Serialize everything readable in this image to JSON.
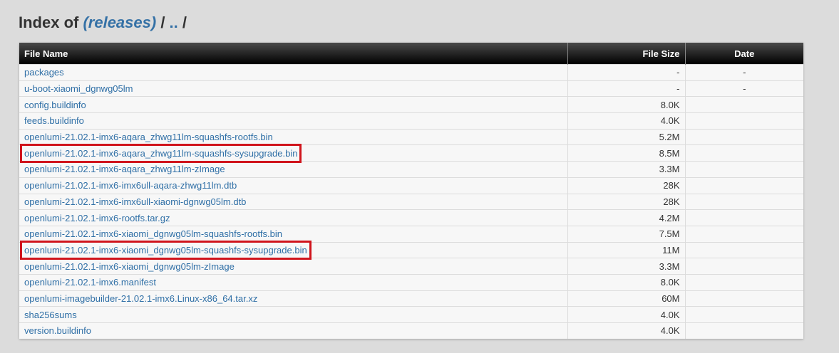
{
  "header": {
    "prefix": "Index of ",
    "root_crumb": "(releases)",
    "sep1": " / ",
    "parent_crumb": "..",
    "sep2": " /"
  },
  "table": {
    "columns": [
      "File Name",
      "File Size",
      "Date"
    ],
    "rows": [
      {
        "name": "packages",
        "size": "-",
        "date": "-",
        "highlighted": false
      },
      {
        "name": "u-boot-xiaomi_dgnwg05lm",
        "size": "-",
        "date": "-",
        "highlighted": false
      },
      {
        "name": "config.buildinfo",
        "size": "8.0K",
        "date": "",
        "highlighted": false
      },
      {
        "name": "feeds.buildinfo",
        "size": "4.0K",
        "date": "",
        "highlighted": false
      },
      {
        "name": "openlumi-21.02.1-imx6-aqara_zhwg11lm-squashfs-rootfs.bin",
        "size": "5.2M",
        "date": "",
        "highlighted": false
      },
      {
        "name": "openlumi-21.02.1-imx6-aqara_zhwg11lm-squashfs-sysupgrade.bin",
        "size": "8.5M",
        "date": "",
        "highlighted": true
      },
      {
        "name": "openlumi-21.02.1-imx6-aqara_zhwg11lm-zImage",
        "size": "3.3M",
        "date": "",
        "highlighted": false
      },
      {
        "name": "openlumi-21.02.1-imx6-imx6ull-aqara-zhwg11lm.dtb",
        "size": "28K",
        "date": "",
        "highlighted": false
      },
      {
        "name": "openlumi-21.02.1-imx6-imx6ull-xiaomi-dgnwg05lm.dtb",
        "size": "28K",
        "date": "",
        "highlighted": false
      },
      {
        "name": "openlumi-21.02.1-imx6-rootfs.tar.gz",
        "size": "4.2M",
        "date": "",
        "highlighted": false
      },
      {
        "name": "openlumi-21.02.1-imx6-xiaomi_dgnwg05lm-squashfs-rootfs.bin",
        "size": "7.5M",
        "date": "",
        "highlighted": false
      },
      {
        "name": "openlumi-21.02.1-imx6-xiaomi_dgnwg05lm-squashfs-sysupgrade.bin",
        "size": "11M",
        "date": "",
        "highlighted": true
      },
      {
        "name": "openlumi-21.02.1-imx6-xiaomi_dgnwg05lm-zImage",
        "size": "3.3M",
        "date": "",
        "highlighted": false
      },
      {
        "name": "openlumi-21.02.1-imx6.manifest",
        "size": "8.0K",
        "date": "",
        "highlighted": false
      },
      {
        "name": "openlumi-imagebuilder-21.02.1-imx6.Linux-x86_64.tar.xz",
        "size": "60M",
        "date": "",
        "highlighted": false
      },
      {
        "name": "sha256sums",
        "size": "4.0K",
        "date": "",
        "highlighted": false
      },
      {
        "name": "version.buildinfo",
        "size": "4.0K",
        "date": "",
        "highlighted": false
      }
    ]
  },
  "colors": {
    "link": "#2f6fa6",
    "highlight_box": "#d0141c",
    "header_bg": "#000000"
  }
}
